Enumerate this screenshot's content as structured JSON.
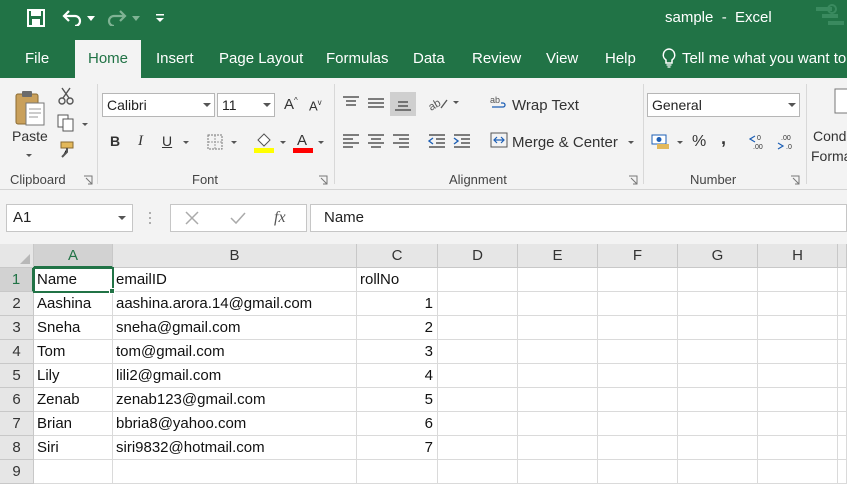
{
  "window": {
    "title": "sample  -  Excel"
  },
  "menu": {
    "tabs": [
      "File",
      "Home",
      "Insert",
      "Page Layout",
      "Formulas",
      "Data",
      "Review",
      "View",
      "Help"
    ],
    "active": "Home",
    "tell_me": "Tell me what you want to"
  },
  "ribbon": {
    "clipboard": {
      "paste_label": "Paste",
      "group_label": "Clipboard"
    },
    "font": {
      "name": "Calibri",
      "size": "11",
      "bold": "B",
      "italic": "I",
      "underline": "U",
      "group_label": "Font",
      "highlight_color": "#ffff00",
      "font_color": "#ff0000"
    },
    "alignment": {
      "wrap_text": "Wrap Text",
      "merge_center": "Merge & Center",
      "group_label": "Alignment"
    },
    "number": {
      "format": "General",
      "percent": "%",
      "comma": ",",
      "group_label": "Number"
    },
    "styles": {
      "conditional_line1": "Cond",
      "conditional_line2": "Forma"
    }
  },
  "formula_bar": {
    "name_box": "A1",
    "fx": "fx",
    "content": "Name"
  },
  "sheet": {
    "columns": [
      "A",
      "B",
      "C",
      "D",
      "E",
      "F",
      "G",
      "H"
    ],
    "active_column": "A",
    "active_row": "1",
    "rows": [
      {
        "row": "1",
        "A": "Name",
        "B": "emailID",
        "C": "rollNo"
      },
      {
        "row": "2",
        "A": "Aashina",
        "B": "aashina.arora.14@gmail.com",
        "C": "1"
      },
      {
        "row": "3",
        "A": "Sneha",
        "B": "sneha@gmail.com",
        "C": "2"
      },
      {
        "row": "4",
        "A": "Tom",
        "B": "tom@gmail.com",
        "C": "3"
      },
      {
        "row": "5",
        "A": "Lily",
        "B": "lili2@gmail.com",
        "C": "4"
      },
      {
        "row": "6",
        "A": "Zenab",
        "B": "zenab123@gmail.com",
        "C": "5"
      },
      {
        "row": "7",
        "A": "Brian",
        "B": "bbria8@yahoo.com",
        "C": "6"
      },
      {
        "row": "8",
        "A": "Siri",
        "B": "siri9832@hotmail.com",
        "C": "7"
      },
      {
        "row": "9",
        "A": "",
        "B": "",
        "C": ""
      }
    ]
  },
  "colors": {
    "brand": "#217346",
    "ribbon_bg": "#f3f3f3",
    "header_bg": "#e6e6e6"
  }
}
